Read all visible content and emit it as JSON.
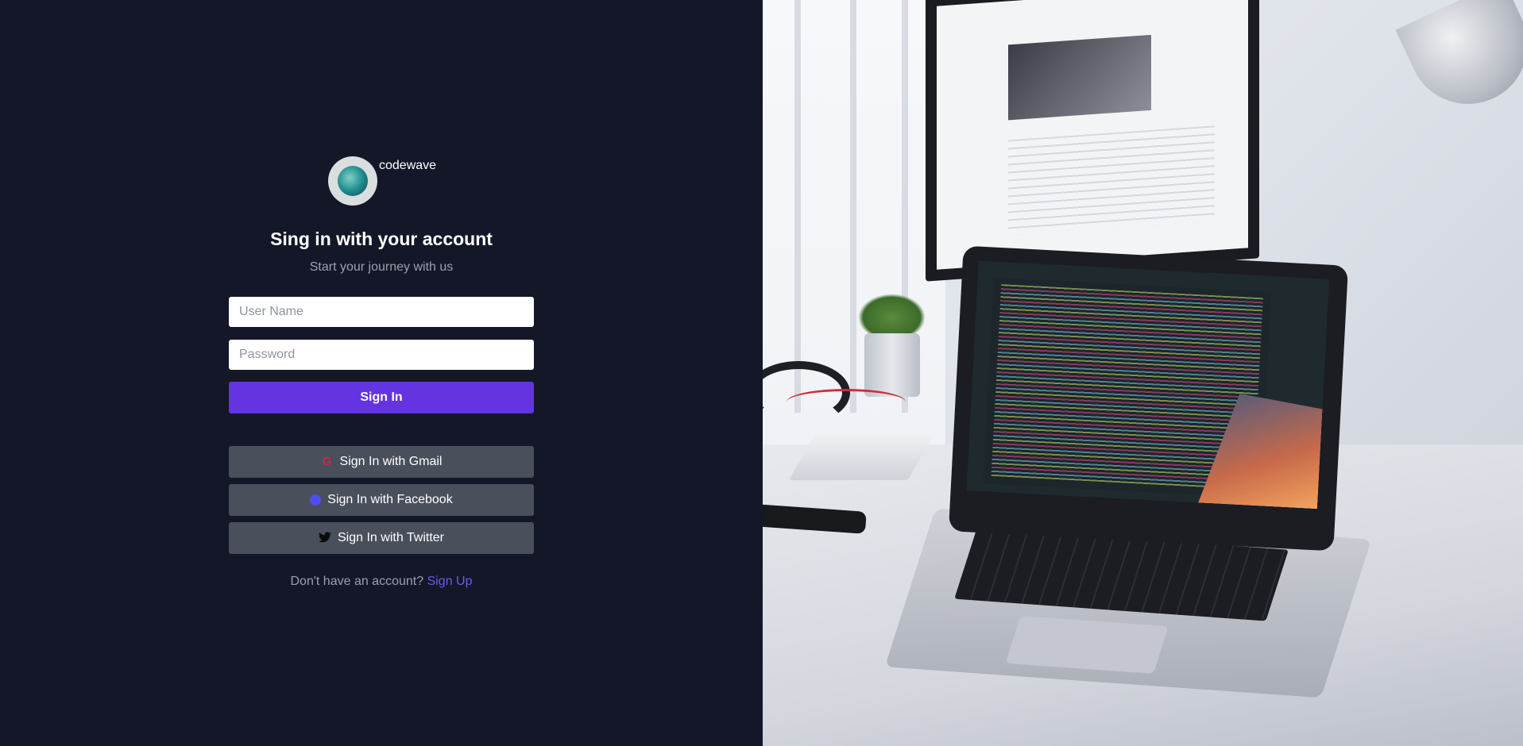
{
  "brand": {
    "name": "codewave",
    "logo_icon": "codewave-logo-icon"
  },
  "form": {
    "title": "Sing in with your account",
    "subtitle": "Start your journey with us",
    "username_placeholder": "User Name",
    "username_value": "",
    "password_placeholder": "Password",
    "password_value": "",
    "signin_label": "Sign In"
  },
  "social": [
    {
      "label": "Sign In with Gmail",
      "icon": "google-icon"
    },
    {
      "label": "Sign In with Facebook",
      "icon": "facebook-icon"
    },
    {
      "label": "Sign In with Twitter",
      "icon": "twitter-icon"
    }
  ],
  "footer": {
    "prompt": "Don't have an account?",
    "signup_label": "Sign Up"
  },
  "colors": {
    "left_background": "#141728",
    "primary_button": "#6434e2",
    "social_button": "#4a4f5c",
    "link": "#6e58f2",
    "google_icon": "#d3214b",
    "facebook_icon": "#4c4ff0"
  },
  "hero_image": {
    "icon": "laptop-desk-photo"
  }
}
